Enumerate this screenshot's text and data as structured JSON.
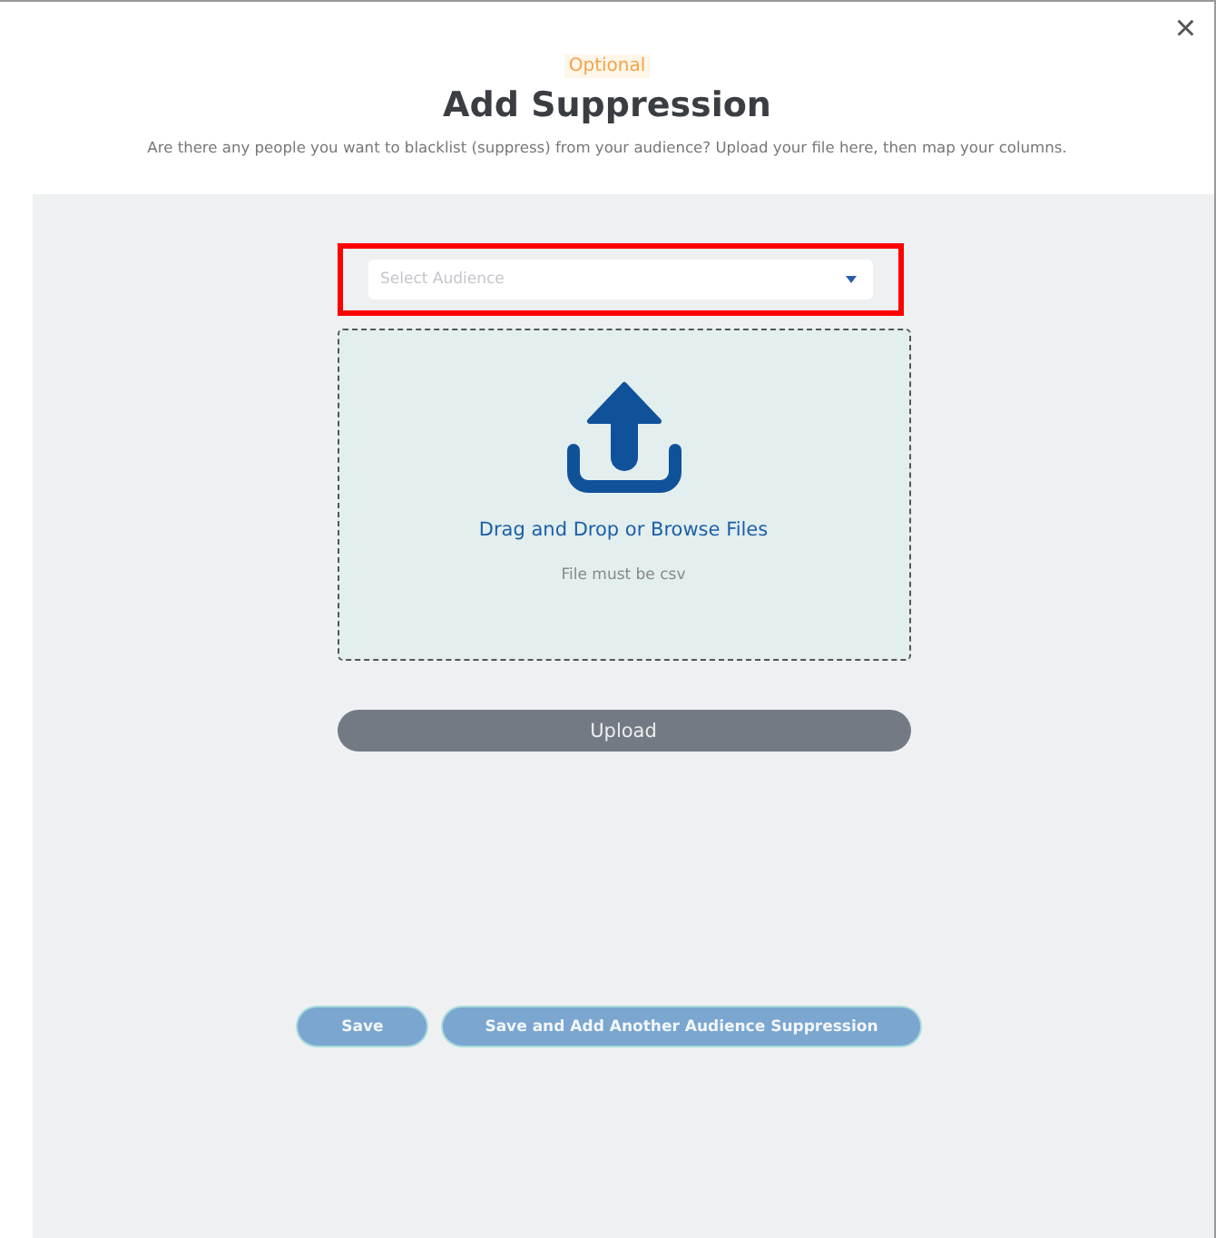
{
  "dialog": {
    "close": "×",
    "badge": "Optional",
    "title": "Add Suppression",
    "subtitle": "Are there any people you want to blacklist (suppress) from your audience? Upload your file here, then map your columns."
  },
  "audience_select": {
    "placeholder": "Select Audience",
    "highlighted": true
  },
  "dropzone": {
    "label": "Drag and Drop or Browse Files",
    "hint": "File must be csv"
  },
  "upload_button": {
    "label": "Upload",
    "disabled": true
  },
  "buttons": [
    {
      "label": "Save"
    },
    {
      "label": "Save and Add Another Audience Suppression"
    }
  ]
}
